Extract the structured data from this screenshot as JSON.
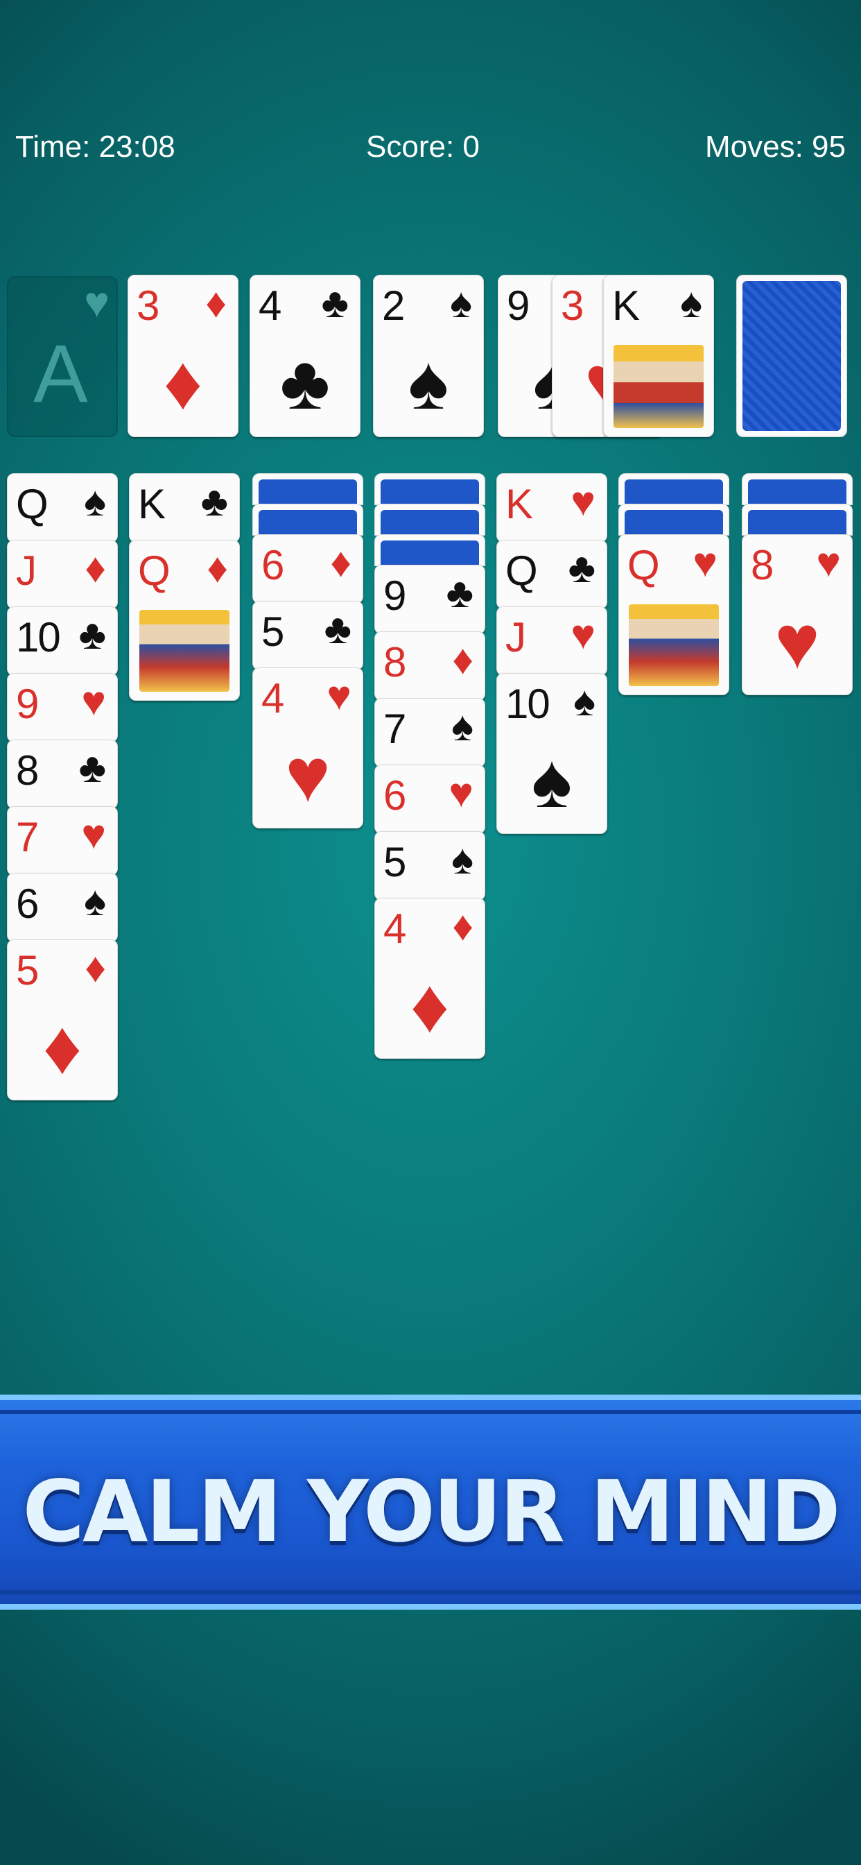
{
  "hud": {
    "time": "Time: 23:08",
    "score": "Score: 0",
    "moves": "Moves: 95"
  },
  "foundation_empty": {
    "rank": "A",
    "suit": "♥"
  },
  "foundations": [
    {
      "rank": "3",
      "suit": "♦",
      "color": "red"
    },
    {
      "rank": "4",
      "suit": "♣",
      "color": "black"
    },
    {
      "rank": "2",
      "suit": "♠",
      "color": "black"
    }
  ],
  "waste": [
    {
      "rank": "9",
      "suit": "♠",
      "color": "black"
    },
    {
      "rank": "3",
      "suit": "♥",
      "color": "red"
    },
    {
      "rank": "K",
      "suit": "♠",
      "color": "black"
    }
  ],
  "tableau": [
    {
      "facedown": 0,
      "cards": [
        {
          "rank": "Q",
          "suit": "♠",
          "color": "black"
        },
        {
          "rank": "J",
          "suit": "♦",
          "color": "red"
        },
        {
          "rank": "10",
          "suit": "♣",
          "color": "black"
        },
        {
          "rank": "9",
          "suit": "♥",
          "color": "red"
        },
        {
          "rank": "8",
          "suit": "♣",
          "color": "black"
        },
        {
          "rank": "7",
          "suit": "♥",
          "color": "red"
        },
        {
          "rank": "6",
          "suit": "♠",
          "color": "black"
        },
        {
          "rank": "5",
          "suit": "♦",
          "color": "red"
        }
      ]
    },
    {
      "facedown": 0,
      "cards": [
        {
          "rank": "K",
          "suit": "♣",
          "color": "black"
        },
        {
          "rank": "Q",
          "suit": "♦",
          "color": "red"
        }
      ]
    },
    {
      "facedown": 2,
      "cards": [
        {
          "rank": "6",
          "suit": "♦",
          "color": "red"
        },
        {
          "rank": "5",
          "suit": "♣",
          "color": "black"
        },
        {
          "rank": "4",
          "suit": "♥",
          "color": "red"
        }
      ]
    },
    {
      "facedown": 3,
      "cards": [
        {
          "rank": "9",
          "suit": "♣",
          "color": "black"
        },
        {
          "rank": "8",
          "suit": "♦",
          "color": "red"
        },
        {
          "rank": "7",
          "suit": "♠",
          "color": "black"
        },
        {
          "rank": "6",
          "suit": "♥",
          "color": "red"
        },
        {
          "rank": "5",
          "suit": "♠",
          "color": "black"
        },
        {
          "rank": "4",
          "suit": "♦",
          "color": "red"
        }
      ]
    },
    {
      "facedown": 0,
      "cards": [
        {
          "rank": "K",
          "suit": "♥",
          "color": "red"
        },
        {
          "rank": "Q",
          "suit": "♣",
          "color": "black"
        },
        {
          "rank": "J",
          "suit": "♥",
          "color": "red"
        },
        {
          "rank": "10",
          "suit": "♠",
          "color": "black"
        }
      ]
    },
    {
      "facedown": 2,
      "cards": [
        {
          "rank": "Q",
          "suit": "♥",
          "color": "red"
        }
      ]
    },
    {
      "facedown": 2,
      "cards": [
        {
          "rank": "8",
          "suit": "♥",
          "color": "red"
        }
      ]
    }
  ],
  "banner": {
    "text": "CALM YOUR MIND"
  },
  "colors": {
    "felt": "#0a7878",
    "red_suit": "#d9302b",
    "card_back": "#1f56c8",
    "banner": "#1e63db"
  }
}
